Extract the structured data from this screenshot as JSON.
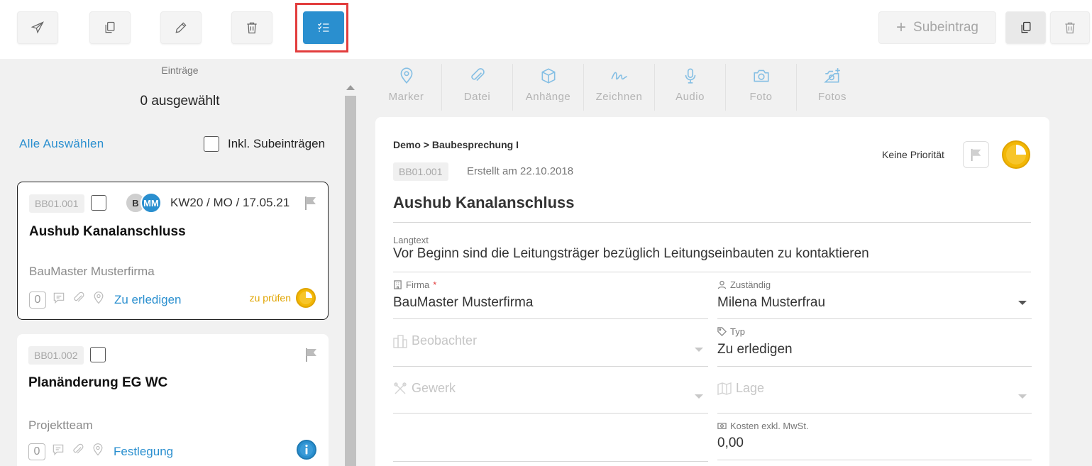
{
  "toolbar": {
    "buttons": [
      {
        "name": "send-button",
        "icon": "paper-plane-icon"
      },
      {
        "name": "copy-button",
        "icon": "copy-icon"
      },
      {
        "name": "edit-button",
        "icon": "pencil-icon"
      },
      {
        "name": "delete-button",
        "icon": "trash-icon"
      },
      {
        "name": "multi-select-button",
        "icon": "checklist-icon",
        "active": true
      }
    ],
    "subeintrag_label": "Subeintrag",
    "right_buttons": [
      {
        "name": "copy-entry-button",
        "icon": "copy-icon"
      },
      {
        "name": "delete-entry-button",
        "icon": "trash-icon"
      }
    ]
  },
  "left_panel": {
    "title": "Einträge",
    "selected_count": "0 ausgewählt",
    "select_all": "Alle Auswählen",
    "include_sub": "Inkl. Subeinträgen",
    "cards": [
      {
        "code": "BB01.001",
        "avatars": [
          "B",
          "MM"
        ],
        "date": "KW20 / MO / 17.05.21",
        "title": "Aushub Kanalanschluss",
        "company": "BauMaster Musterfirma",
        "count": "0",
        "type": "Zu erledigen",
        "status_text": "zu prüfen",
        "status_icon": "clock-pie-icon",
        "selected": true
      },
      {
        "code": "BB01.002",
        "avatars": [],
        "date": "",
        "title": "Planänderung EG WC",
        "company": "Projektteam",
        "count": "0",
        "type": "Festlegung",
        "status_text": "",
        "status_icon": "info-icon",
        "selected": false
      }
    ]
  },
  "attachments_toolbar": [
    {
      "label": "Marker",
      "icon": "map-pin-icon"
    },
    {
      "label": "Datei",
      "icon": "paperclip-icon"
    },
    {
      "label": "Anhänge",
      "icon": "cube-icon"
    },
    {
      "label": "Zeichnen",
      "icon": "signature-icon"
    },
    {
      "label": "Audio",
      "icon": "microphone-icon"
    },
    {
      "label": "Foto",
      "icon": "camera-icon"
    },
    {
      "label": "Fotos",
      "icon": "camera-plus-icon"
    }
  ],
  "detail": {
    "breadcrumb": "Demo > Baubesprechung I",
    "code": "BB01.001",
    "created": "Erstellt am 22.10.2018",
    "priority_label": "Keine Priorität",
    "title": "Aushub Kanalanschluss",
    "langtext_label": "Langtext",
    "langtext_value": "Vor Beginn sind die Leitungsträger bezüglich Leitungseinbauten zu kontaktieren",
    "firma_label": "Firma",
    "firma_required": "*",
    "firma_value": "BauMaster Musterfirma",
    "zustaendig_label": "Zuständig",
    "zustaendig_value": "Milena Musterfrau",
    "beobachter_placeholder": "Beobachter",
    "typ_label": "Typ",
    "typ_value": "Zu erledigen",
    "gewerk_placeholder": "Gewerk",
    "lage_placeholder": "Lage",
    "kosten_label": "Kosten exkl. MwSt.",
    "kosten_value": "0,00"
  },
  "colors": {
    "accent": "#2a8fcf",
    "highlight": "#e23d3d",
    "status_yellow": "#f2b705",
    "status_text": "#e0a400"
  }
}
